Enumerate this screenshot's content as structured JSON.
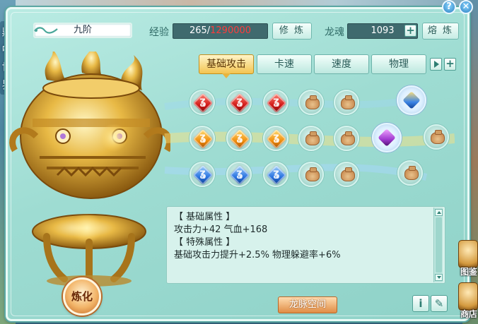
{
  "side_text": [
    "鼎",
    "中",
    "世",
    "界"
  ],
  "header": {
    "name": "九阶",
    "exp_label": "经验",
    "exp_current": "265/",
    "exp_max": "1290000",
    "cultivate_label": "修 炼",
    "soul_label": "龙魂",
    "soul_value": "1093",
    "smelt_label": "熔 炼"
  },
  "tabs": [
    {
      "label": "基础攻击",
      "active": true
    },
    {
      "label": "卡速",
      "active": false
    },
    {
      "label": "速度",
      "active": false
    },
    {
      "label": "物理",
      "active": false
    }
  ],
  "gem_grid": {
    "rows": [
      [
        "red",
        "red",
        "red",
        "bag",
        "bag"
      ],
      [
        "orange",
        "orange",
        "orange",
        "bag",
        "bag"
      ],
      [
        "blue",
        "blue",
        "blue",
        "bag",
        "bag"
      ]
    ],
    "branch_nodes": [
      "blue-yellow gem",
      "purple gem",
      "bag",
      "bag"
    ]
  },
  "info": {
    "basic_header": "【 基础属性 】",
    "basic_line": "攻击力+42  气血+168",
    "special_header": "【 特殊属性 】",
    "special_line": "基础攻击力提升+2.5%  物理躲避率+6%"
  },
  "buttons": {
    "refine": "炼化",
    "dragon_space": "龙脉空间",
    "help": "?",
    "close": "✕",
    "info": "i"
  },
  "edge_labels": {
    "atlas": "图鉴",
    "shop": "商店"
  }
}
